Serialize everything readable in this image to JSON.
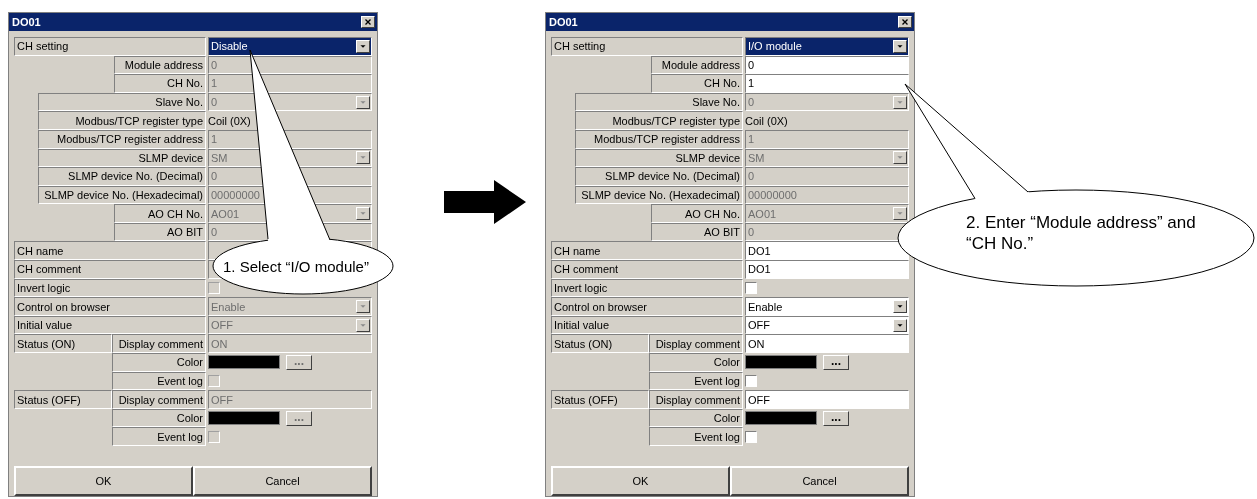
{
  "dialogs": [
    {
      "title": "DO01",
      "rows": [
        {
          "label": "CH setting",
          "kind": "top",
          "control": {
            "kind": "select",
            "value": "Disable",
            "disabled": false,
            "highlighted": true
          }
        },
        {
          "label": "Module address",
          "kind": "subsub",
          "control": {
            "kind": "text",
            "value": "0",
            "disabled": true
          }
        },
        {
          "label": "CH No.",
          "kind": "subsub",
          "control": {
            "kind": "text",
            "value": "1",
            "disabled": true
          }
        },
        {
          "label": "Slave No.",
          "kind": "sub",
          "control": {
            "kind": "select",
            "value": "0",
            "disabled": true,
            "highlighted": false
          }
        },
        {
          "label": "Modbus/TCP register type",
          "kind": "sub",
          "control": {
            "kind": "static",
            "value": "Coil (0X)"
          }
        },
        {
          "label": "Modbus/TCP register address",
          "kind": "sub",
          "control": {
            "kind": "text",
            "value": "1",
            "disabled": true
          }
        },
        {
          "label": "SLMP device",
          "kind": "sub",
          "control": {
            "kind": "select",
            "value": "SM",
            "disabled": true,
            "highlighted": false
          }
        },
        {
          "label": "SLMP device No. (Decimal)",
          "kind": "sub",
          "control": {
            "kind": "text",
            "value": "0",
            "disabled": true
          }
        },
        {
          "label": "SLMP device No. (Hexadecimal)",
          "kind": "sub",
          "control": {
            "kind": "text",
            "value": "00000000",
            "disabled": true
          }
        },
        {
          "label": "AO CH No.",
          "kind": "subsub",
          "control": {
            "kind": "select",
            "value": "AO01",
            "disabled": true,
            "highlighted": false
          }
        },
        {
          "label": "AO BIT",
          "kind": "subsub",
          "control": {
            "kind": "text",
            "value": "0",
            "disabled": true
          }
        },
        {
          "label": "CH name",
          "kind": "top",
          "control": {
            "kind": "text",
            "disabled": true
          }
        },
        {
          "label": "CH comment",
          "kind": "top",
          "control": {
            "kind": "text",
            "disabled": true
          }
        },
        {
          "label": "Invert logic",
          "kind": "top",
          "control": {
            "kind": "checkbox",
            "checked": false,
            "disabled": true
          }
        },
        {
          "label": "Control on browser",
          "kind": "top",
          "control": {
            "kind": "select",
            "value": "Enable",
            "disabled": true,
            "highlighted": false
          }
        },
        {
          "label": "Initial value",
          "kind": "top",
          "control": {
            "kind": "select",
            "value": "OFF",
            "disabled": true,
            "highlighted": false
          }
        },
        {
          "group": "Status (ON)",
          "label": "Display comment",
          "kind": "status",
          "control": {
            "kind": "text",
            "value": "ON",
            "disabled": true
          }
        },
        {
          "label": "Color",
          "kind": "status",
          "control": {
            "kind": "color",
            "button_label": "...",
            "disabled": true
          }
        },
        {
          "label": "Event log",
          "kind": "status",
          "control": {
            "kind": "checkbox",
            "checked": false,
            "disabled": true
          }
        },
        {
          "group": "Status (OFF)",
          "label": "Display comment",
          "kind": "status",
          "control": {
            "kind": "text",
            "value": "OFF",
            "disabled": true
          }
        },
        {
          "label": "Color",
          "kind": "status",
          "control": {
            "kind": "color",
            "button_label": "...",
            "disabled": true
          }
        },
        {
          "label": "Event log",
          "kind": "status",
          "control": {
            "kind": "checkbox",
            "checked": false,
            "disabled": true
          }
        }
      ],
      "buttons": [
        "OK",
        "Cancel"
      ]
    },
    {
      "title": "DO01",
      "rows": [
        {
          "label": "CH setting",
          "kind": "top",
          "control": {
            "kind": "select",
            "value": "I/O module",
            "disabled": false,
            "highlighted": true
          }
        },
        {
          "label": "Module address",
          "kind": "subsub",
          "control": {
            "kind": "text",
            "value": "0",
            "disabled": false
          }
        },
        {
          "label": "CH No.",
          "kind": "subsub",
          "control": {
            "kind": "text",
            "value": "1",
            "disabled": false
          }
        },
        {
          "label": "Slave No.",
          "kind": "sub",
          "control": {
            "kind": "select",
            "value": "0",
            "disabled": true,
            "highlighted": false
          }
        },
        {
          "label": "Modbus/TCP register type",
          "kind": "sub",
          "control": {
            "kind": "static",
            "value": "Coil (0X)"
          }
        },
        {
          "label": "Modbus/TCP register address",
          "kind": "sub",
          "control": {
            "kind": "text",
            "value": "1",
            "disabled": true
          }
        },
        {
          "label": "SLMP device",
          "kind": "sub",
          "control": {
            "kind": "select",
            "value": "SM",
            "disabled": true,
            "highlighted": false
          }
        },
        {
          "label": "SLMP device No. (Decimal)",
          "kind": "sub",
          "control": {
            "kind": "text",
            "value": "0",
            "disabled": true
          }
        },
        {
          "label": "SLMP device No. (Hexadecimal)",
          "kind": "sub",
          "control": {
            "kind": "text",
            "value": "00000000",
            "disabled": true
          }
        },
        {
          "label": "AO CH No.",
          "kind": "subsub",
          "control": {
            "kind": "select",
            "value": "AO01",
            "disabled": true,
            "highlighted": false
          }
        },
        {
          "label": "AO BIT",
          "kind": "subsub",
          "control": {
            "kind": "text",
            "value": "0",
            "disabled": true
          }
        },
        {
          "label": "CH name",
          "kind": "top",
          "control": {
            "kind": "text",
            "value": "DO1",
            "disabled": false
          }
        },
        {
          "label": "CH comment",
          "kind": "top",
          "control": {
            "kind": "text",
            "value": "DO1",
            "disabled": false
          }
        },
        {
          "label": "Invert logic",
          "kind": "top",
          "control": {
            "kind": "checkbox",
            "checked": false,
            "disabled": false
          }
        },
        {
          "label": "Control on browser",
          "kind": "top",
          "control": {
            "kind": "select",
            "value": "Enable",
            "disabled": false,
            "highlighted": false
          }
        },
        {
          "label": "Initial value",
          "kind": "top",
          "control": {
            "kind": "select",
            "value": "OFF",
            "disabled": false,
            "highlighted": false
          }
        },
        {
          "group": "Status (ON)",
          "label": "Display comment",
          "kind": "status",
          "control": {
            "kind": "text",
            "value": "ON",
            "disabled": false
          }
        },
        {
          "label": "Color",
          "kind": "status",
          "control": {
            "kind": "color",
            "button_label": "...",
            "disabled": false
          }
        },
        {
          "label": "Event log",
          "kind": "status",
          "control": {
            "kind": "checkbox",
            "checked": false,
            "disabled": false
          }
        },
        {
          "group": "Status (OFF)",
          "label": "Display comment",
          "kind": "status",
          "control": {
            "kind": "text",
            "value": "OFF",
            "disabled": false
          }
        },
        {
          "label": "Color",
          "kind": "status",
          "control": {
            "kind": "color",
            "button_label": "...",
            "disabled": false
          }
        },
        {
          "label": "Event log",
          "kind": "status",
          "control": {
            "kind": "checkbox",
            "checked": false,
            "disabled": false
          }
        }
      ],
      "buttons": [
        "OK",
        "Cancel"
      ]
    }
  ],
  "callouts": [
    {
      "text": "1. Select “I/O module”"
    },
    {
      "text": "2. Enter “Module address” and “CH No.”"
    }
  ]
}
